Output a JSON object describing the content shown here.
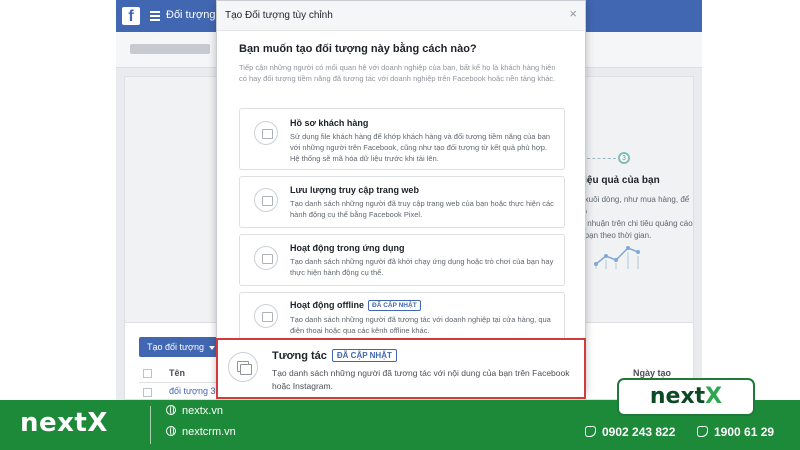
{
  "app": {
    "top_title": "Đối tượng",
    "logo_glyph": "f"
  },
  "background": {
    "step_number": "3",
    "heading": "hiệu quả của bạn",
    "text": "n xuôi dòng, như mua hàng, để đo\nơi nhuận trên chi tiêu quảng cáo\nn bạn theo thời gian.",
    "create_audience_label": "Tạo đối tượng",
    "table_col_name": "Tên",
    "table_col_date": "Ngày tạo",
    "table_row_name": "đối tượng 30 n"
  },
  "modal": {
    "title": "Tạo Đối tượng tùy chỉnh",
    "close_glyph": "×",
    "question": "Bạn muốn tạo đối tượng này bằng cách nào?",
    "description": "Tiếp cận những người có mối quan hệ với doanh nghiệp của bạn, bất kể họ là khách hàng hiện có hay đối tượng tiềm năng đã tương tác với doanh nghiệp trên Facebook hoặc nền tảng khác.",
    "options": [
      {
        "name": "Hồ sơ khách hàng",
        "text": "Sử dụng file khách hàng để khớp khách hàng và đối tượng tiềm năng của bạn với những người trên Facebook, cũng như tạo đối tượng từ kết quả phù hợp. Hệ thống sẽ mã hóa dữ liệu trước khi tải lên.",
        "icon": "customer-file-icon"
      },
      {
        "name": "Lưu lượng truy cập trang web",
        "text": "Tạo danh sách những người đã truy cập trang web của bạn hoặc thực hiện các hành động cụ thể bằng Facebook Pixel.",
        "icon": "website-icon"
      },
      {
        "name": "Hoạt động trong ứng dụng",
        "text": "Tạo danh sách những người đã khởi chạy ứng dụng hoặc trò chơi của bạn hay thực hiện hành động cụ thể.",
        "icon": "app-icon"
      },
      {
        "name": "Hoạt động offline",
        "badge": "ĐÃ CẬP NHẬT",
        "text": "Tạo danh sách những người đã tương tác với doanh nghiệp tại cửa hàng, qua điện thoại hoặc qua các kênh offline khác.",
        "icon": "offline-icon"
      }
    ],
    "highlighted": {
      "name": "Tương tác",
      "badge": "ĐÃ CẬP NHẬT",
      "text": "Tạo danh sách những người đã tương tác với nội dung của bạn trên Facebook hoặc Instagram.",
      "icon": "engagement-icon"
    }
  },
  "brand": {
    "badge_word": "next",
    "badge_x": "X",
    "footer_logo": "nextX",
    "link1": "nextx.vn",
    "link2": "nextcrm.vn",
    "phone1": "0902 243 822",
    "phone2": "1900 61 29"
  },
  "colors": {
    "facebook_blue": "#4267b2",
    "highlight_red": "#d23b3b",
    "brand_green": "#1d8a3a"
  }
}
